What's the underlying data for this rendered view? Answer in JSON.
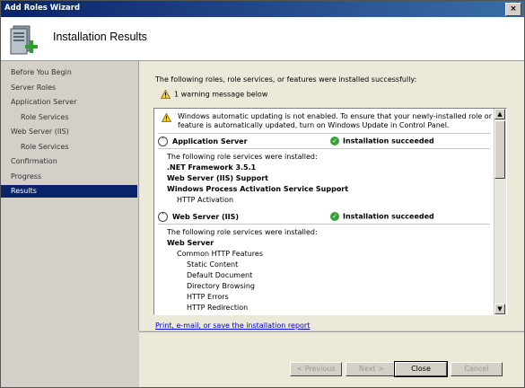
{
  "window": {
    "title": "Add Roles Wizard",
    "close_glyph": "×"
  },
  "header": {
    "title": "Installation Results",
    "icon": "server-add-icon"
  },
  "sidebar": {
    "items": [
      {
        "label": "Before You Begin",
        "sub": false,
        "active": false
      },
      {
        "label": "Server Roles",
        "sub": false,
        "active": false
      },
      {
        "label": "Application Server",
        "sub": false,
        "active": false
      },
      {
        "label": "Role Services",
        "sub": true,
        "active": false
      },
      {
        "label": "Web Server (IIS)",
        "sub": false,
        "active": false
      },
      {
        "label": "Role Services",
        "sub": true,
        "active": false
      },
      {
        "label": "Confirmation",
        "sub": false,
        "active": false
      },
      {
        "label": "Progress",
        "sub": false,
        "active": false
      },
      {
        "label": "Results",
        "sub": false,
        "active": true
      }
    ]
  },
  "main": {
    "intro": "The following roles, role services, or features were installed successfully:",
    "warning_count": "1 warning message below",
    "warning_note": "Windows automatic updating is not enabled. To ensure that your newly-installed role or feature is automatically updated, turn on Windows Update in Control Panel.",
    "sections": [
      {
        "name": "Application Server",
        "status": "Installation succeeded",
        "intro": "The following role services were installed:",
        "lines": [
          {
            "text": ".NET Framework 3.5.1",
            "bold": true,
            "indent": 0
          },
          {
            "text": "Web Server (IIS) Support",
            "bold": true,
            "indent": 0
          },
          {
            "text": "Windows Process Activation Service Support",
            "bold": true,
            "indent": 0
          },
          {
            "text": "HTTP Activation",
            "bold": false,
            "indent": 1
          }
        ]
      },
      {
        "name": "Web Server (IIS)",
        "status": "Installation succeeded",
        "intro": "The following role services were installed:",
        "lines": [
          {
            "text": "Web Server",
            "bold": true,
            "indent": 0
          },
          {
            "text": "Common HTTP Features",
            "bold": false,
            "indent": 1
          },
          {
            "text": "Static Content",
            "bold": false,
            "indent": 2
          },
          {
            "text": "Default Document",
            "bold": false,
            "indent": 2
          },
          {
            "text": "Directory Browsing",
            "bold": false,
            "indent": 2
          },
          {
            "text": "HTTP Errors",
            "bold": false,
            "indent": 2
          },
          {
            "text": "HTTP Redirection",
            "bold": false,
            "indent": 2
          }
        ]
      }
    ],
    "report_link": "Print, e-mail, or save the installation report"
  },
  "footer": {
    "previous": "< Previous",
    "next": "Next >",
    "close": "Close",
    "cancel": "Cancel"
  }
}
